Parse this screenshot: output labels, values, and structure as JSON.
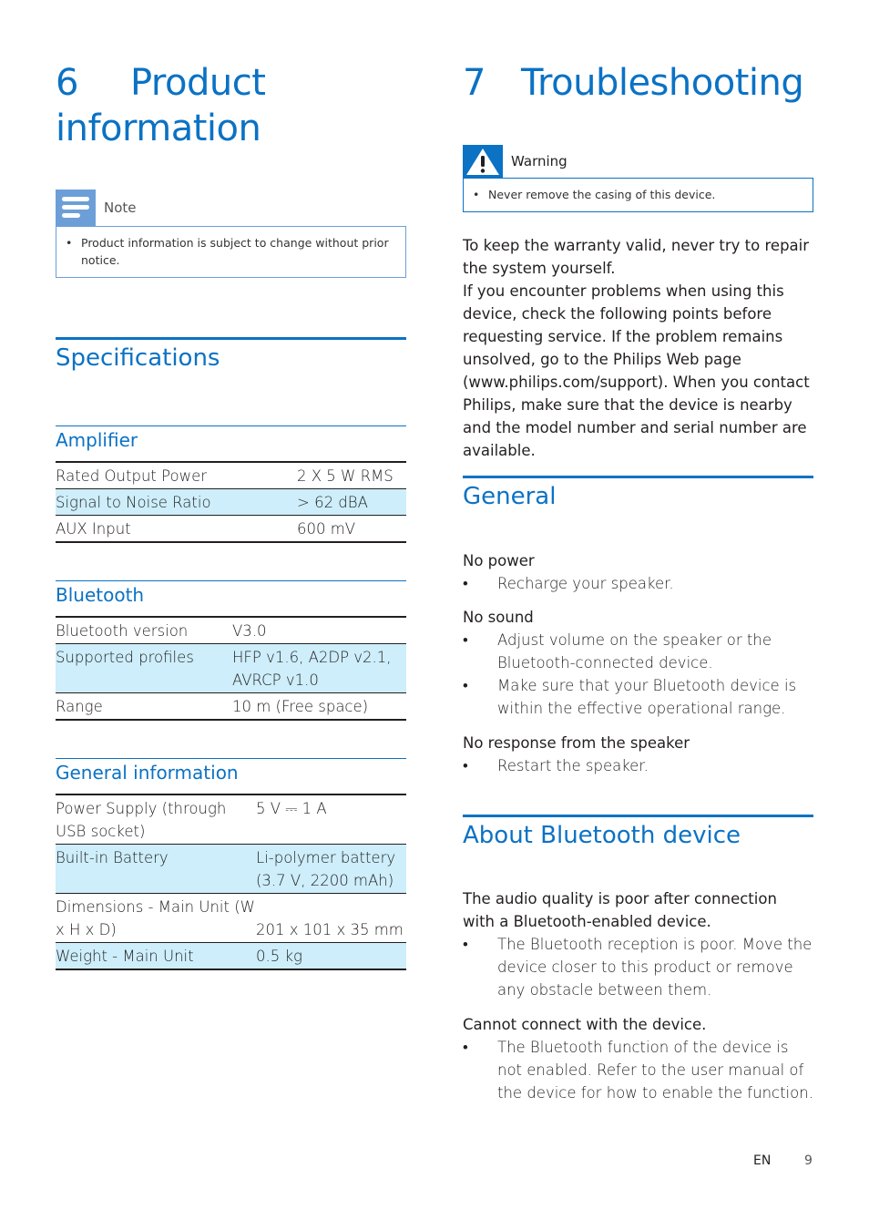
{
  "left": {
    "chapter_number": "6",
    "chapter_title": "Product",
    "chapter_title_line2": "information",
    "note": {
      "label": "Note",
      "icon": "note-icon",
      "text": "Product information is subject to change without prior notice."
    },
    "section_title": "Specifications",
    "tables": [
      {
        "title": "Amplifier",
        "rows": [
          {
            "label": "Rated Output Power",
            "value": "2 X 5 W RMS"
          },
          {
            "label": "Signal to Noise Ratio",
            "value": "> 62 dBA"
          },
          {
            "label": "AUX Input",
            "value": "600 mV"
          }
        ]
      },
      {
        "title": "Bluetooth",
        "rows": [
          {
            "label": "Bluetooth version",
            "value": "V3.0"
          },
          {
            "label": "Supported profiles",
            "value": "HFP v1.6, A2DP v2.1, AVRCP v1.0"
          },
          {
            "label": "Range",
            "value": "10 m (Free space)"
          }
        ]
      },
      {
        "title": "General information",
        "rows": [
          {
            "label": "Power Supply (through USB socket)",
            "value": "5 V ⎓ 1 A"
          },
          {
            "label": "Built-in Battery",
            "value": "Li-polymer battery (3.7 V, 2200 mAh)"
          },
          {
            "label": "Dimensions - Main Unit (W x H x D)",
            "value": "201 x 101 x 35 mm"
          },
          {
            "label": "Weight - Main Unit",
            "value": "0.5 kg"
          }
        ]
      }
    ]
  },
  "right": {
    "chapter_number": "7",
    "chapter_title": "Troubleshooting",
    "warning": {
      "label": "Warning",
      "icon": "warning-icon",
      "text": "Never remove the casing of this device."
    },
    "intro": [
      "To keep the warranty valid, never try to repair the system yourself.",
      "If you encounter problems when using this device, check the following points before requesting service. If the problem remains unsolved, go to the Philips Web page (www.philips.com/support). When you contact Philips, make sure that the device is nearby and the model number and serial number are available."
    ],
    "sections": [
      {
        "title": "General",
        "issues": [
          {
            "title": "No power",
            "items": [
              "Recharge your speaker."
            ]
          },
          {
            "title": "No sound",
            "items": [
              "Adjust volume on the speaker or the Bluetooth-connected device.",
              "Make sure that your Bluetooth device is within the effective operational range."
            ]
          },
          {
            "title": "No response from the speaker",
            "items": [
              "Restart the speaker."
            ]
          }
        ]
      },
      {
        "title": "About Bluetooth device",
        "issues": [
          {
            "title": "The audio quality is poor after connection with a Bluetooth-enabled device.",
            "items": [
              "The Bluetooth reception is poor. Move the device closer to this product or remove any obstacle between them."
            ]
          },
          {
            "title": "Cannot connect with the device.",
            "items": [
              "The Bluetooth function of the device is not enabled. Refer to the user manual of the device for how to enable the function."
            ]
          }
        ]
      }
    ]
  },
  "footer": {
    "language": "EN",
    "page_number": "9"
  },
  "colors": {
    "accent": "#0b72c4",
    "note_icon_bg": "#6c9fd8",
    "row_shade": "#cdeefa",
    "text": "#231f20"
  },
  "bullet": "•"
}
